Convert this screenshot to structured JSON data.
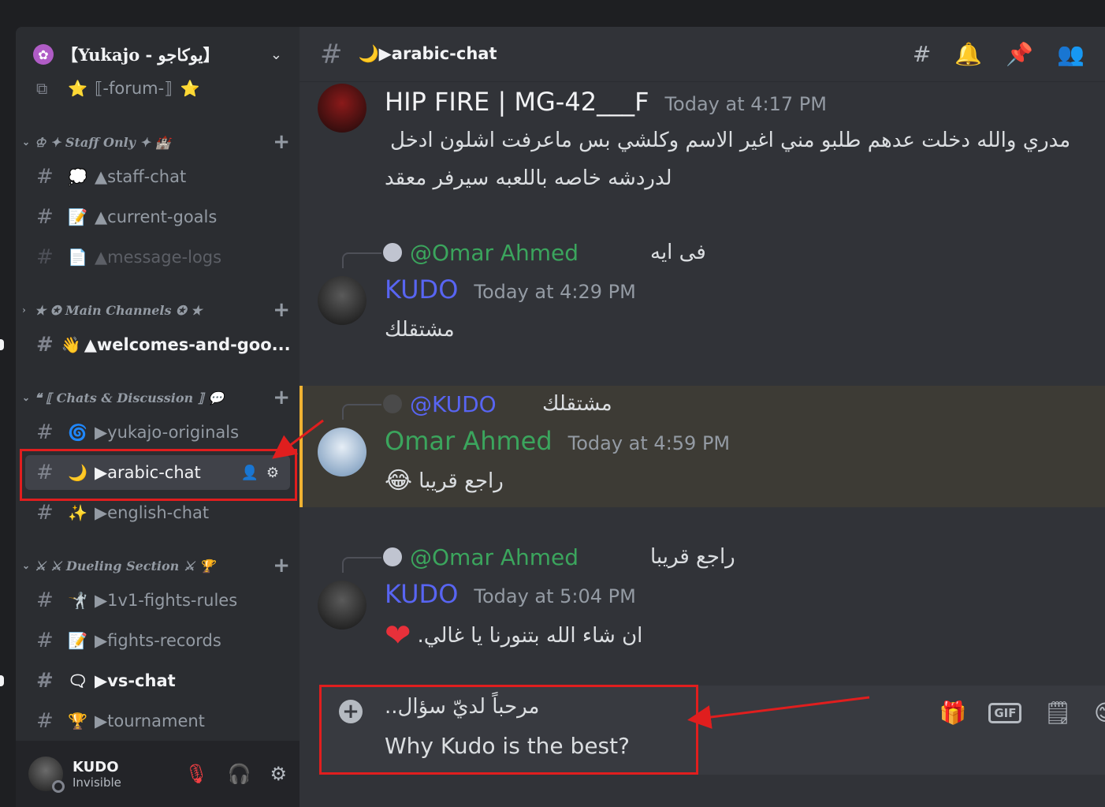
{
  "server": {
    "name": "【Yukajo - يوكاجو】"
  },
  "sidebar": {
    "forum": {
      "emoji_left": "⭐",
      "label": "⟦-forum-⟧",
      "emoji_right": "⭐"
    },
    "categories": [
      {
        "label": "♔ ✦ Staff Only ✦ 🏰",
        "arrow": "⌄"
      },
      {
        "label": "★ ✪ Main Channels ✪ ★",
        "arrow": "›"
      },
      {
        "label": "❝ ⟦ Chats & Discussion ⟧ 💬",
        "arrow": "⌄"
      },
      {
        "label": "⚔ ⚔ Dueling Section ⚔ 🏆",
        "arrow": "⌄"
      }
    ],
    "channels": [
      {
        "emoji": "💭",
        "label": "▲staff-chat"
      },
      {
        "emoji": "📝",
        "label": "▲current-goals"
      },
      {
        "emoji": "📄",
        "label": "▲message-logs"
      },
      {
        "emoji": "👋",
        "label": "▲welcomes-and-goo..."
      },
      {
        "emoji": "🌀",
        "label": "▶yukajo-originals"
      },
      {
        "emoji": "🌙",
        "label": "▶arabic-chat"
      },
      {
        "emoji": "✨",
        "label": "▶english-chat"
      },
      {
        "emoji": "🤺",
        "label": "▶1v1-fights-rules"
      },
      {
        "emoji": "📝",
        "label": "▶fights-records"
      },
      {
        "emoji": "🗨",
        "label": "▶vs-chat"
      },
      {
        "emoji": "🏆",
        "label": "▶tournament"
      }
    ],
    "user": {
      "name": "KUDO",
      "status": "Invisible"
    }
  },
  "channel_header": {
    "title": "🌙▶arabic-chat"
  },
  "messages": [
    {
      "author": "HIP FIRE | MG-42___F",
      "time": "Today at 4:17 PM",
      "line1": "مدري والله دخلت عدهم طلبو مني اغير الاسم وكلشي بس ماعرفت اشلون ادخل",
      "line2": "لدردشه خاصه باللعبه سيرفر معقد"
    },
    {
      "reply_to": "@Omar Ahmed",
      "reply_text": "فى ايه",
      "author": "KUDO",
      "time": "Today at 4:29 PM",
      "line1": "مشتقلك"
    },
    {
      "reply_to": "@KUDO",
      "reply_text": "مشتقلك",
      "author": "Omar Ahmed",
      "time": "Today at 4:59 PM",
      "line1": "راجع قريبا"
    },
    {
      "reply_to": "@Omar Ahmed",
      "reply_text": "راجع قريبا",
      "author": "KUDO",
      "time": "Today at 5:04 PM",
      "line1": "ان شاء الله بتنورنا يا غالي."
    }
  ],
  "composer": {
    "line1": "مرحباً لديّ سؤال..",
    "line2": "Why Kudo is the best?",
    "gif_label": "GIF"
  },
  "colors": {
    "annotation_red": "#e01e1e",
    "mention_green": "#3ba55d",
    "kudo_blue": "#5865f2",
    "omar_green": "#3ba55d"
  }
}
